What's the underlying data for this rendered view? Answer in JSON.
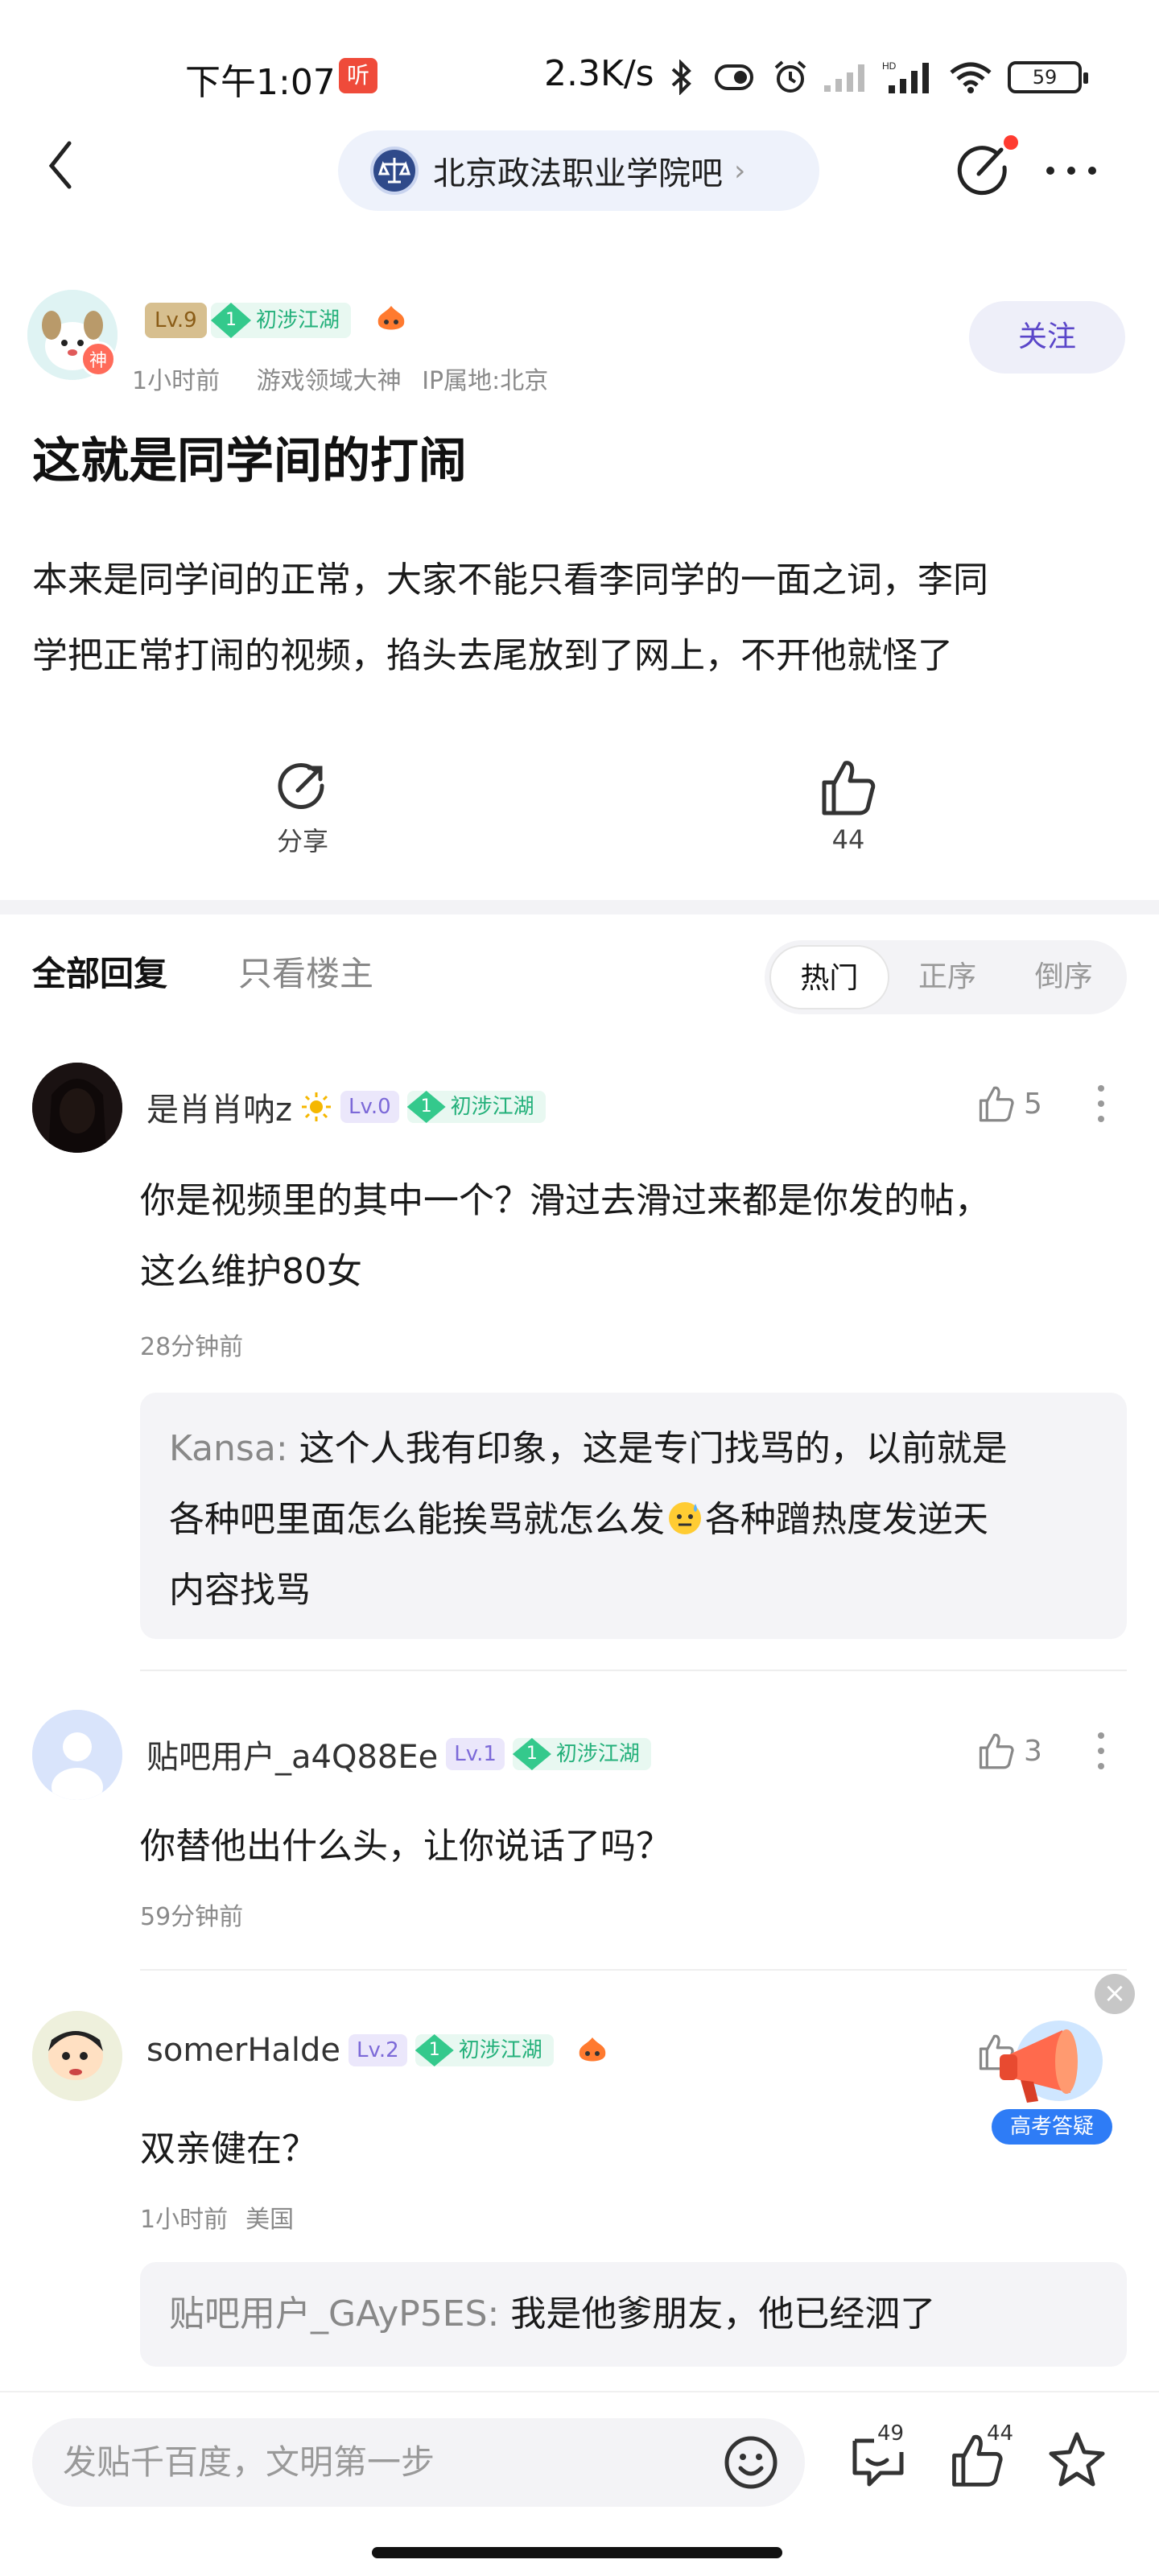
{
  "status_bar": {
    "time": "下午1:07",
    "notification_badge": "听",
    "network_speed": "2.3K/s",
    "battery": "59"
  },
  "nav": {
    "forum_name": "北京政法职业学院吧",
    "chevron": "›"
  },
  "author": {
    "god_badge": "神",
    "level": "Lv.9",
    "rank_num": "1",
    "rank": "初涉江湖",
    "time": "1小时前",
    "title": "游戏领域大神",
    "ip": "IP属地:北京",
    "follow_label": "关注"
  },
  "post": {
    "title": "这就是同学间的打闹",
    "body_line1": "本来是同学间的正常，大家不能只看李同学的一面之词，李同",
    "body_line2": "学把正常打闹的视频，掐头去尾放到了网上，不开他就怪了"
  },
  "actions": {
    "share_label": "分享",
    "like_count": "44"
  },
  "tabs": {
    "all_replies": "全部回复",
    "owner_only": "只看楼主",
    "sort": [
      "热门",
      "正序",
      "倒序"
    ],
    "active_sort": "热门"
  },
  "comments": [
    {
      "name": "是肖肖呐z",
      "level": "Lv.0",
      "rank_num": "1",
      "rank": "初涉江湖",
      "likes": "5",
      "text_line1": "你是视频里的其中一个？滑过去滑过来都是你发的帖，",
      "text_line2": "这么维护80女",
      "time": "28分钟前",
      "reply_name": "Kansa:",
      "reply_line1": "这个人我有印象，这是专门找骂的，以前就是",
      "reply_line2": "各种吧里面怎么能挨骂就怎么发",
      "reply_line2b": "各种蹭热度发逆天",
      "reply_line3": "内容找骂"
    },
    {
      "name": "贴吧用户_a4Q88Ee",
      "level": "Lv.1",
      "rank_num": "1",
      "rank": "初涉江湖",
      "likes": "3",
      "text_line1": "你替他出什么头，让你说话了吗？",
      "time": "59分钟前"
    },
    {
      "name": "somerHalde",
      "level": "Lv.2",
      "rank_num": "1",
      "rank": "初涉江湖",
      "text_line1": "双亲健在？",
      "time": "1小时前",
      "location": "美国",
      "reply_name": "贴吧用户_GAyP5ES:",
      "reply_line1": "我是他爹朋友，他已经泗了"
    }
  ],
  "floating_ad": {
    "label": "高考答疑",
    "close": "×"
  },
  "bottom_bar": {
    "input_placeholder": "发贴千百度，文明第一步",
    "comment_count": "49",
    "like_count": "44"
  }
}
